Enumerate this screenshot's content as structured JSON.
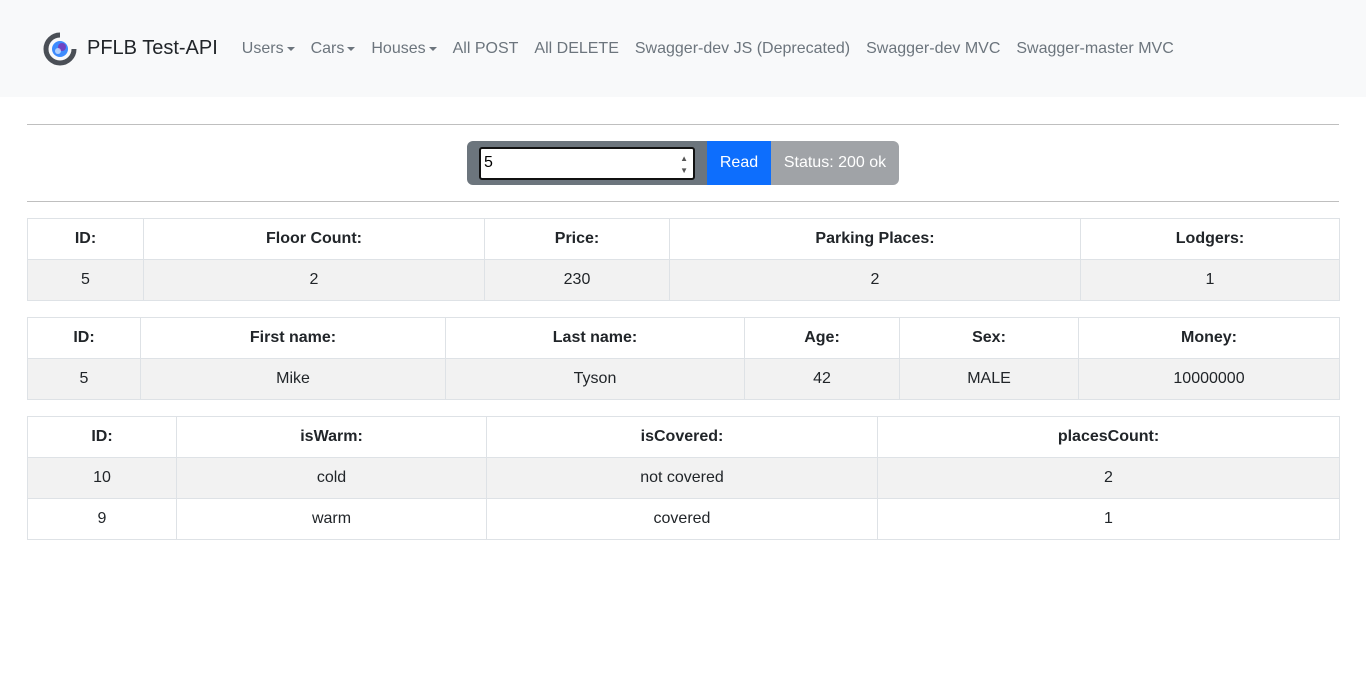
{
  "navbar": {
    "brand": "PFLB Test-API",
    "links": [
      {
        "label": "Users",
        "dropdown": true
      },
      {
        "label": "Cars",
        "dropdown": true
      },
      {
        "label": "Houses",
        "dropdown": true
      },
      {
        "label": "All POST",
        "dropdown": false
      },
      {
        "label": "All DELETE",
        "dropdown": false
      },
      {
        "label": "Swagger-dev JS (Deprecated)",
        "dropdown": false
      },
      {
        "label": "Swagger-dev MVC",
        "dropdown": false
      },
      {
        "label": "Swagger-master MVC",
        "dropdown": false
      }
    ]
  },
  "reader": {
    "input_value": "5",
    "read_label": "Read",
    "status_text": "Status: 200 ok"
  },
  "house_table": {
    "headers": [
      "ID:",
      "Floor Count:",
      "Price:",
      "Parking Places:",
      "Lodgers:"
    ],
    "rows": [
      [
        "5",
        "2",
        "230",
        "2",
        "1"
      ]
    ]
  },
  "lodger_table": {
    "headers": [
      "ID:",
      "First name:",
      "Last name:",
      "Age:",
      "Sex:",
      "Money:"
    ],
    "rows": [
      [
        "5",
        "Mike",
        "Tyson",
        "42",
        "MALE",
        "10000000"
      ]
    ]
  },
  "parking_table": {
    "headers": [
      "ID:",
      "isWarm:",
      "isCovered:",
      "placesCount:"
    ],
    "rows": [
      [
        "10",
        "cold",
        "not covered",
        "2"
      ],
      [
        "9",
        "warm",
        "covered",
        "1"
      ]
    ]
  },
  "colors": {
    "accent": "#0d6efd",
    "navbar_bg": "#f8f9fa",
    "input_group_bg": "#6c757d",
    "status_bg": "#a0a3a7"
  }
}
